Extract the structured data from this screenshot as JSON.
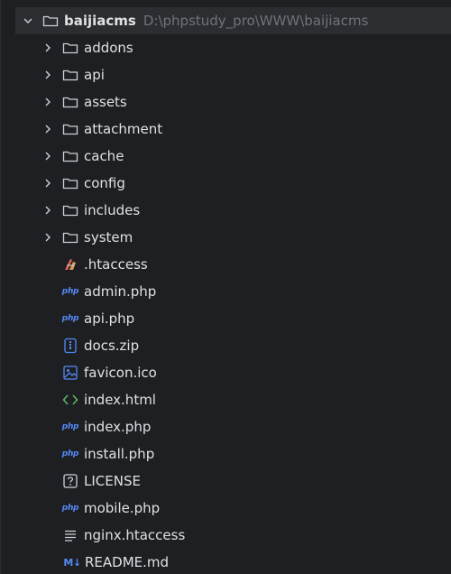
{
  "root": {
    "name": "baijiacms",
    "path": "D:\\phpstudy_pro\\WWW\\baijiacms"
  },
  "folders": [
    {
      "name": "addons"
    },
    {
      "name": "api"
    },
    {
      "name": "assets"
    },
    {
      "name": "attachment"
    },
    {
      "name": "cache"
    },
    {
      "name": "config"
    },
    {
      "name": "includes"
    },
    {
      "name": "system"
    }
  ],
  "files": [
    {
      "name": ".htaccess",
      "icon": "htaccess-icon"
    },
    {
      "name": "admin.php",
      "icon": "php-file-icon",
      "badge": "php"
    },
    {
      "name": "api.php",
      "icon": "php-file-icon",
      "badge": "php"
    },
    {
      "name": "docs.zip",
      "icon": "archive-icon"
    },
    {
      "name": "favicon.ico",
      "icon": "image-icon"
    },
    {
      "name": "index.html",
      "icon": "html-icon"
    },
    {
      "name": "index.php",
      "icon": "php-file-icon",
      "badge": "php"
    },
    {
      "name": "install.php",
      "icon": "php-file-icon",
      "badge": "php"
    },
    {
      "name": "LICENSE",
      "icon": "license-icon"
    },
    {
      "name": "mobile.php",
      "icon": "php-file-icon",
      "badge": "php"
    },
    {
      "name": "nginx.htaccess",
      "icon": "text-file-icon"
    },
    {
      "name": "README.md",
      "icon": "markdown-icon",
      "badge": "M↓"
    }
  ],
  "colors": {
    "background": "#1e1f22",
    "root_row": "#2b2d30",
    "text": "#dfe1e5",
    "path": "#6f737a",
    "php": "#548af7",
    "html": "#5fb865",
    "icon": "#ced0d6"
  }
}
